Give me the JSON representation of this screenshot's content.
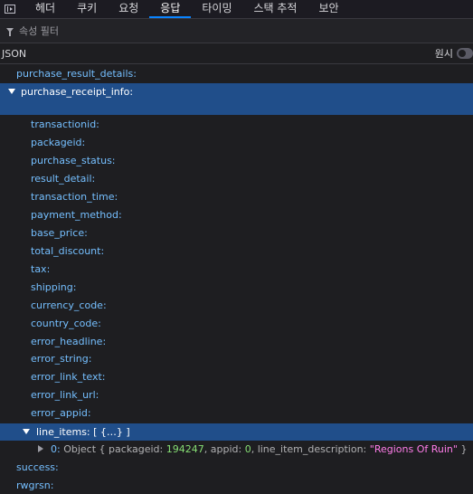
{
  "tabs": [
    "헤더",
    "쿠키",
    "요청",
    "응답",
    "타이밍",
    "스택 추적",
    "보안"
  ],
  "selected_tab": "응답",
  "filter": {
    "placeholder": "속성 필터",
    "value": ""
  },
  "viewer": {
    "mode_label": "JSON",
    "raw_label": "원시",
    "raw_enabled": false
  },
  "tree": {
    "purchase_result_details": "purchase_result_details:",
    "purchase_receipt_info": "purchase_receipt_info:",
    "receipt_fields": [
      "transactionid:",
      "packageid:",
      "purchase_status:",
      "result_detail:",
      "transaction_time:",
      "payment_method:",
      "base_price:",
      "total_discount:",
      "tax:",
      "shipping:",
      "currency_code:",
      "country_code:",
      "error_headline:",
      "error_string:",
      "error_link_text:",
      "error_link_url:",
      "error_appid:"
    ],
    "line_items": {
      "key": "line_items:",
      "preview": "[ {…} ]"
    },
    "line_item_0": {
      "index": "0:",
      "type": "Object",
      "open": "{",
      "packageid_key": "packageid:",
      "packageid": "194247",
      "appid_key": "appid:",
      "appid": "0",
      "description_key": "line_item_description:",
      "description": "\"Regions Of Ruin\"",
      "close": "}"
    },
    "success": "success:",
    "rwgrsn": "rwgrsn:"
  }
}
